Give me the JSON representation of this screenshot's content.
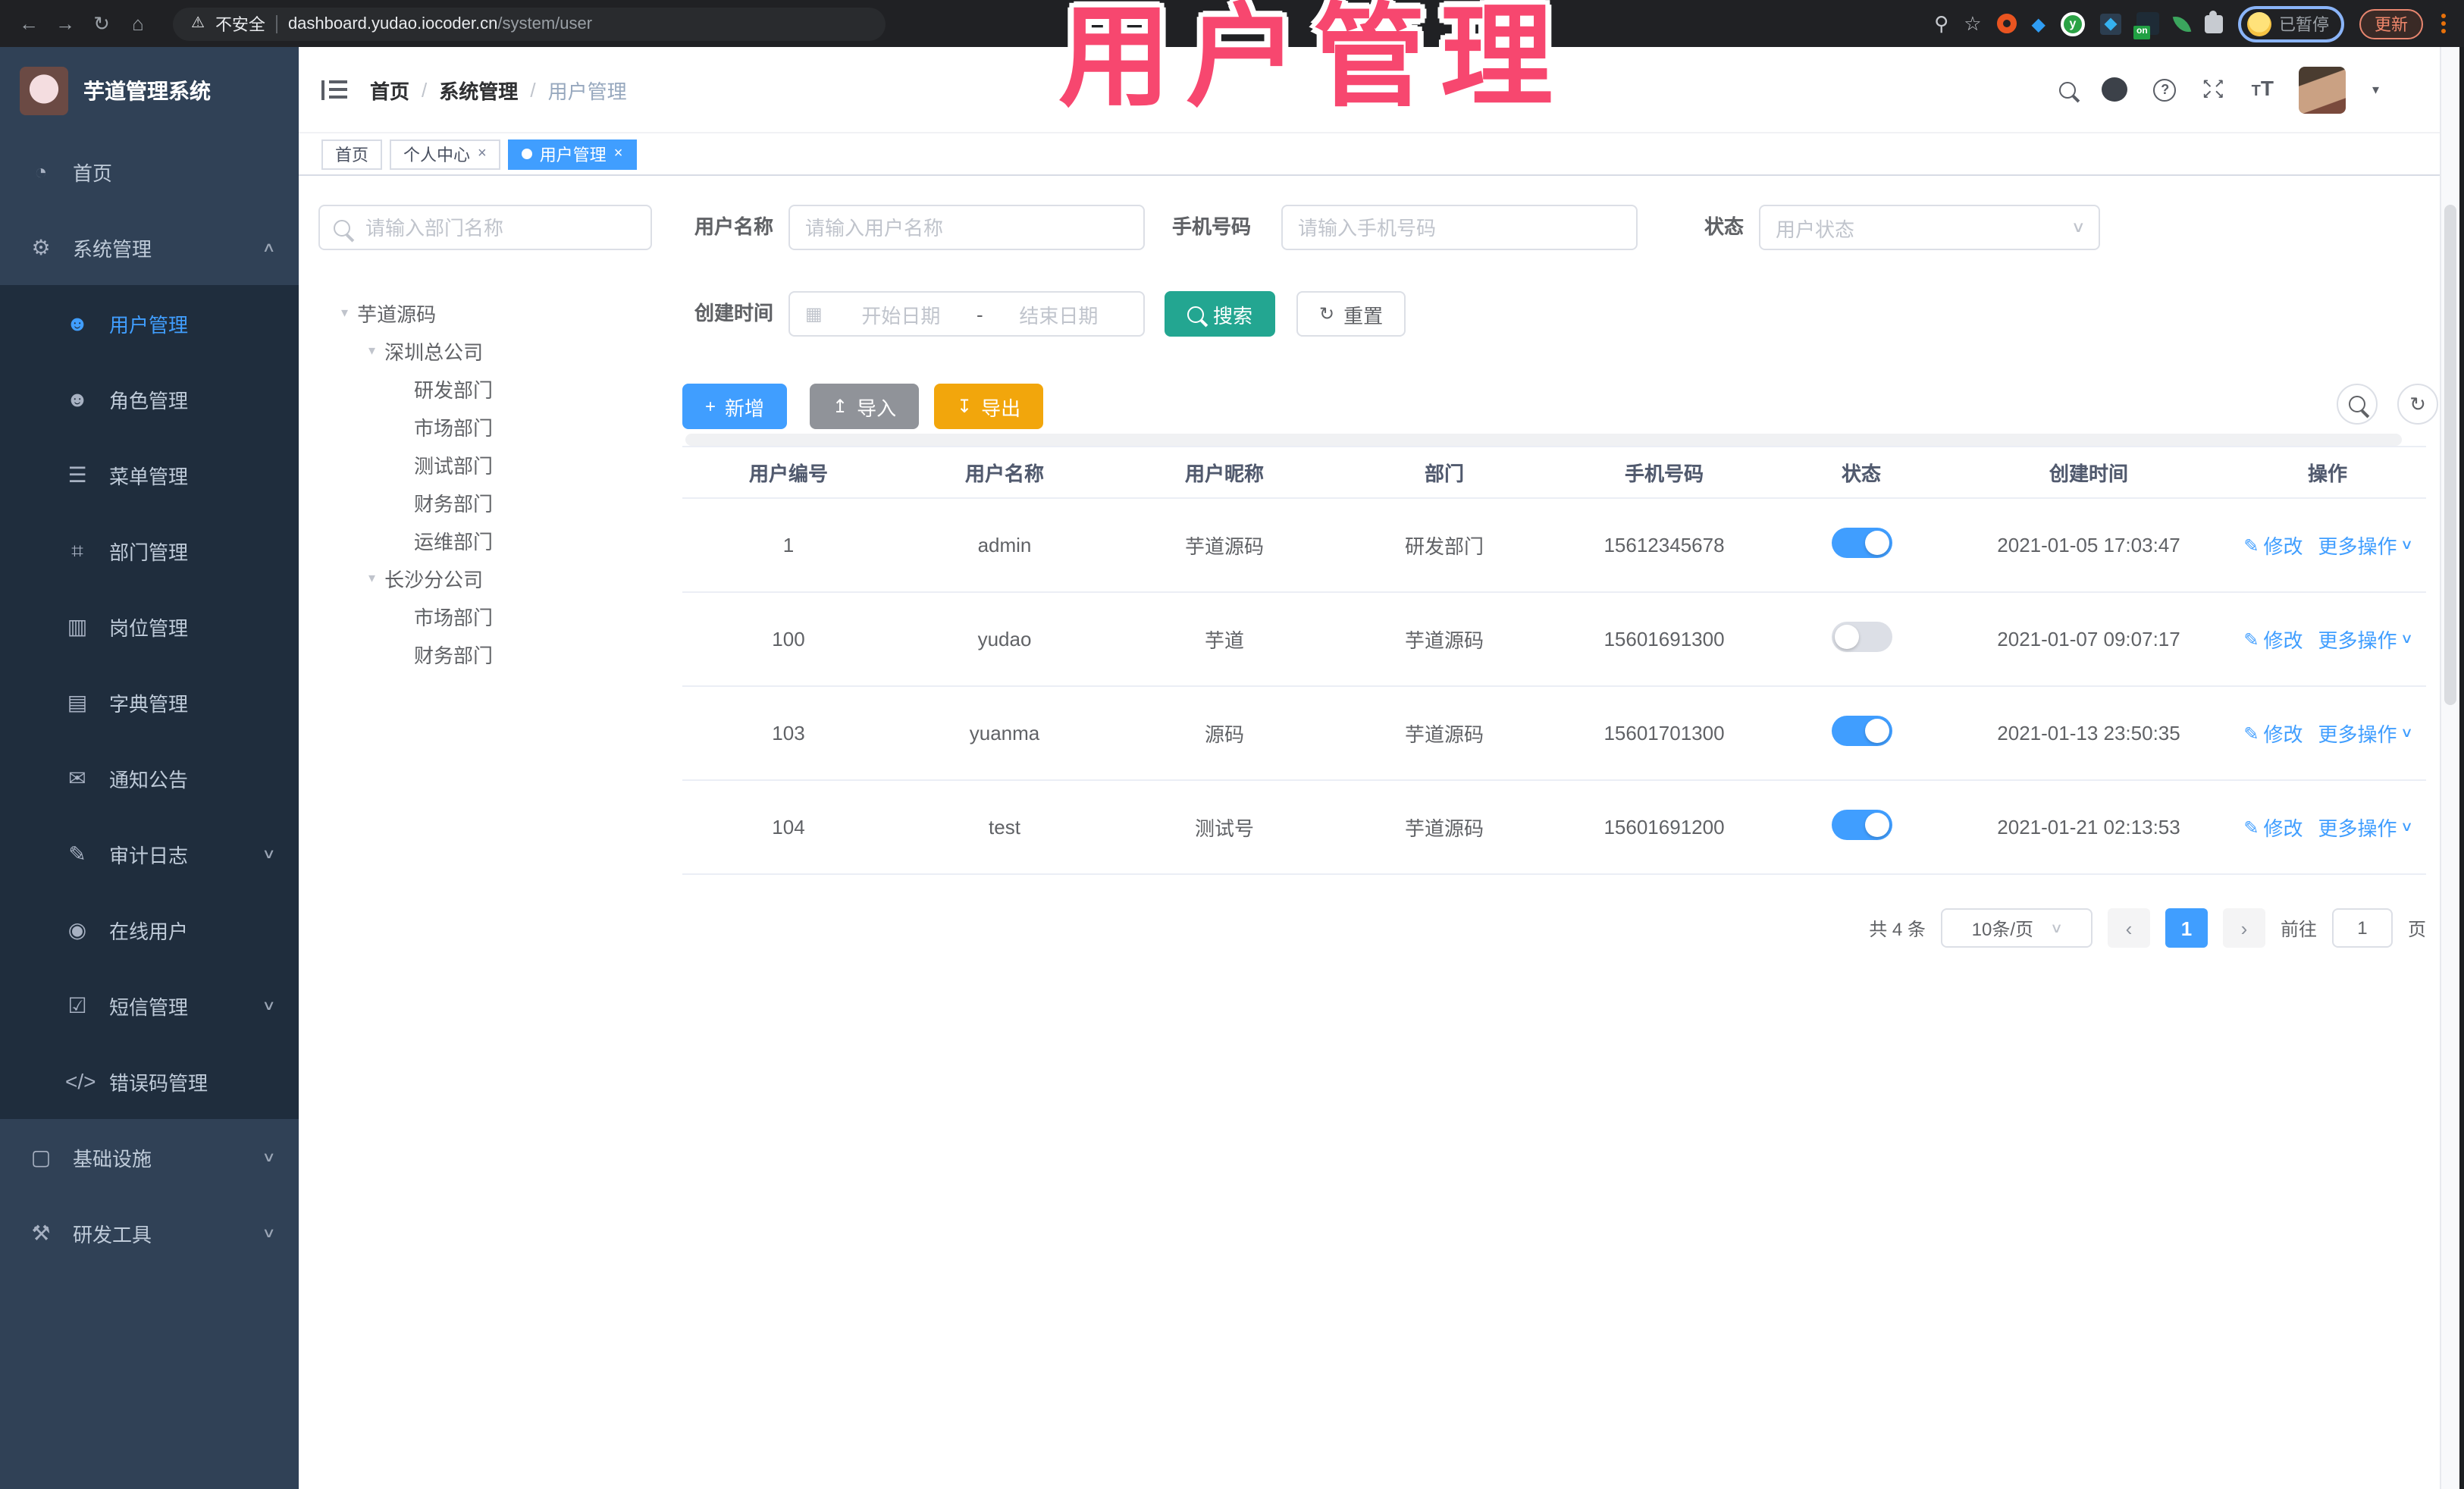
{
  "watermark_text": "用户管理",
  "colors": {
    "primary": "#409EFF",
    "search_button": "#23A691",
    "import_button": "#909399",
    "export_button": "#F2A60C",
    "watermark_pink": "#F7476F",
    "sidebar_bg": "#304156",
    "submenu_bg": "#1F2D3D",
    "toggle_on": "#409EFF"
  },
  "icons": {
    "back": "←",
    "forward": "→",
    "reload": "↻",
    "home": "⌂",
    "warning": "⚠",
    "key": "⚲",
    "star": "☆",
    "extension_on_badge": "on",
    "help": "?",
    "caret_down": "▾",
    "fullscreen_top": "↖↗",
    "fullscreen_bottom": "↙↘",
    "text_small": "T",
    "text_big": "T",
    "dashboard": "◔",
    "gear": "⚙",
    "user": "☻",
    "role": "☻",
    "menu": "☰",
    "dept": "⌗",
    "post": "▥",
    "dict": "▤",
    "notice": "✉",
    "audit": "✎",
    "online": "◉",
    "sms": "☑",
    "code": "</>",
    "infra": "▢",
    "tools": "⚒",
    "chevron_up": "∧",
    "chevron_down": "∨",
    "plus": "+",
    "upload": "↥",
    "download": "↧",
    "refresh": "↻",
    "edit": "✎",
    "calendar": "▦",
    "tree_arrow": "▾",
    "prev": "‹",
    "next": "›"
  },
  "browser": {
    "security_label": "不安全",
    "url_host": "dashboard.yudao.iocoder.cn",
    "url_path": "/system/user",
    "profile_status": "已暂停",
    "update_label": "更新"
  },
  "header": {
    "logo_title": "芋道管理系统",
    "breadcrumb": [
      "首页",
      "系统管理",
      "用户管理"
    ],
    "breadcrumb_sep": "/"
  },
  "tabs": [
    {
      "label": "首页"
    },
    {
      "label": "个人中心"
    },
    {
      "label": "用户管理"
    }
  ],
  "sidebar": {
    "top_items": [
      {
        "label": "首页"
      },
      {
        "label": "系统管理"
      }
    ],
    "system_children": [
      "用户管理",
      "角色管理",
      "菜单管理",
      "部门管理",
      "岗位管理",
      "字典管理",
      "通知公告",
      "审计日志",
      "在线用户",
      "短信管理",
      "错误码管理"
    ],
    "bottom_items": [
      {
        "label": "基础设施"
      },
      {
        "label": "研发工具"
      }
    ]
  },
  "dept_panel": {
    "search_placeholder": "请输入部门名称",
    "tree": [
      "芋道源码",
      "深圳总公司",
      "研发部门",
      "市场部门",
      "测试部门",
      "财务部门",
      "运维部门",
      "长沙分公司",
      "市场部门",
      "财务部门"
    ]
  },
  "filters": {
    "username_label": "用户名称",
    "username_placeholder": "请输入用户名称",
    "mobile_label": "手机号码",
    "mobile_placeholder": "请输入手机号码",
    "status_label": "状态",
    "status_placeholder": "用户状态",
    "time_label": "创建时间",
    "start_placeholder": "开始日期",
    "range_separator": "-",
    "end_placeholder": "结束日期",
    "search_label": "搜索",
    "reset_label": "重置"
  },
  "toolbar": {
    "add_label": "新增",
    "import_label": "导入",
    "export_label": "导出"
  },
  "table": {
    "headers": [
      "用户编号",
      "用户名称",
      "用户昵称",
      "部门",
      "手机号码",
      "状态",
      "创建时间",
      "操作"
    ],
    "actions": {
      "edit": "修改",
      "more": "更多操作"
    },
    "rows": [
      {
        "id": "1",
        "username": "admin",
        "nickname": "芋道源码",
        "dept": "研发部门",
        "mobile": "15612345678",
        "status": "on",
        "created": "2021-01-05 17:03:47"
      },
      {
        "id": "100",
        "username": "yudao",
        "nickname": "芋道",
        "dept": "芋道源码",
        "mobile": "15601691300",
        "status": "off",
        "created": "2021-01-07 09:07:17"
      },
      {
        "id": "103",
        "username": "yuanma",
        "nickname": "源码",
        "dept": "芋道源码",
        "mobile": "15601701300",
        "status": "on",
        "created": "2021-01-13 23:50:35"
      },
      {
        "id": "104",
        "username": "test",
        "nickname": "测试号",
        "dept": "芋道源码",
        "mobile": "15601691200",
        "status": "on",
        "created": "2021-01-21 02:13:53"
      }
    ]
  },
  "pagination": {
    "total_text": "共 4 条",
    "page_size": "10条/页",
    "current_page": "1",
    "goto_label": "前往",
    "goto_value": "1",
    "page_unit": "页"
  }
}
